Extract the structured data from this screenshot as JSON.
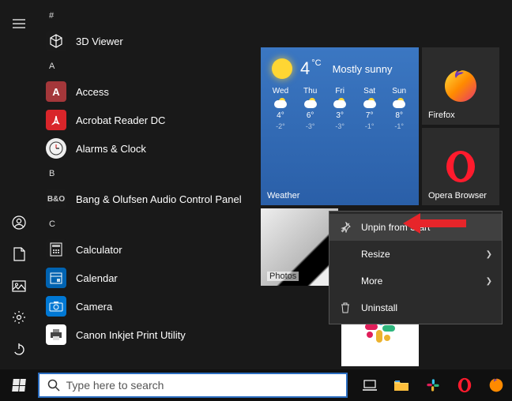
{
  "app_groups": {
    "g1": "#",
    "g2": "A",
    "g3": "B",
    "g4": "C"
  },
  "apps": {
    "viewer3d": "3D Viewer",
    "access": "Access",
    "acrobat": "Acrobat Reader DC",
    "alarms": "Alarms & Clock",
    "bangolufsen": "Bang & Olufsen Audio Control Panel",
    "calculator": "Calculator",
    "calendar": "Calendar",
    "camera": "Camera",
    "canon": "Canon Inkjet Print Utility"
  },
  "weather": {
    "label": "Weather",
    "temp": "4",
    "unit": "°C",
    "cond": "Mostly sunny",
    "days": [
      {
        "d": "Wed",
        "hi": "4°",
        "lo": "-2°"
      },
      {
        "d": "Thu",
        "hi": "6°",
        "lo": "-3°"
      },
      {
        "d": "Fri",
        "hi": "3°",
        "lo": "-3°"
      },
      {
        "d": "Sat",
        "hi": "7°",
        "lo": "-1°"
      },
      {
        "d": "Sun",
        "hi": "8°",
        "lo": "-1°"
      }
    ]
  },
  "tiles": {
    "firefox": "Firefox",
    "opera": "Opera Browser",
    "photos": "Photos"
  },
  "context_menu": {
    "unpin": "Unpin from Start",
    "resize": "Resize",
    "more": "More",
    "uninstall": "Uninstall"
  },
  "taskbar": {
    "search_placeholder": "Type here to search"
  }
}
